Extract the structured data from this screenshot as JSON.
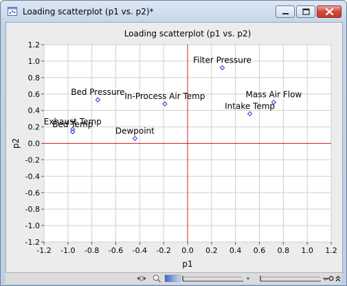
{
  "window": {
    "title": "Loading scatterplot (p1 vs. p2)*"
  },
  "colors": {
    "axis_line": "#d21f1f",
    "point": "#1a2fd6",
    "grid": "#cfcfcf",
    "plot_bg": "#ffffff"
  },
  "icons": {
    "app": "scatterplot-app-icon",
    "minimize": "minimize-icon",
    "maximize": "maximize-icon",
    "close": "close-icon",
    "toolbar": [
      "pan-arrows-icon",
      "zoom-icon",
      "color-scale-icon",
      "slider-track",
      "range-dots-icon",
      "slider-track",
      "key-icon",
      "double-chevron-up-icon"
    ]
  },
  "chart_data": {
    "type": "scatter",
    "title": "Loading scatterplot (p1 vs. p2)",
    "xlabel": "p1",
    "ylabel": "p2",
    "xlim": [
      -1.2,
      1.2
    ],
    "ylim": [
      -1.2,
      1.2
    ],
    "xticks": [
      "-1.2",
      "-1.0",
      "-0.8",
      "-0.6",
      "-0.4",
      "-0.2",
      "0.0",
      "0.2",
      "0.4",
      "0.6",
      "0.8",
      "1.0",
      "1.2"
    ],
    "yticks": [
      "1.2",
      "1.0",
      "0.8",
      "0.6",
      "0.4",
      "0.2",
      "0.0",
      "-0.2",
      "-0.4",
      "-0.6",
      "-0.8",
      "-1.0",
      "-1.2"
    ],
    "grid": true,
    "points": [
      {
        "label": "Filter Pressure",
        "x": 0.29,
        "y": 0.92
      },
      {
        "label": "Bed Pressure",
        "x": -0.75,
        "y": 0.53
      },
      {
        "label": "In-Process Air Temp",
        "x": -0.19,
        "y": 0.48
      },
      {
        "label": "Mass Air Flow",
        "x": 0.72,
        "y": 0.5
      },
      {
        "label": "Intake Temp",
        "x": 0.52,
        "y": 0.36
      },
      {
        "label": "Exhaust Temp",
        "x": -0.96,
        "y": 0.17
      },
      {
        "label": "Bed Temp",
        "x": -0.96,
        "y": 0.14
      },
      {
        "label": "Dewpoint",
        "x": -0.44,
        "y": 0.06
      }
    ]
  }
}
